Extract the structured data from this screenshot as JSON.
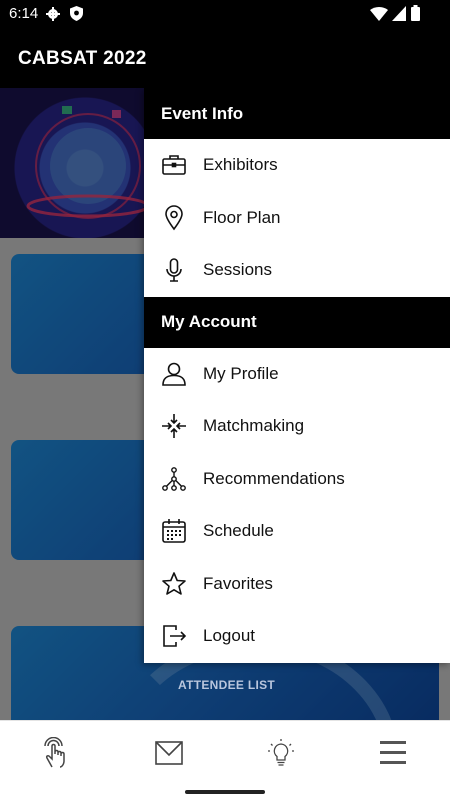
{
  "status_bar": {
    "time": "6:14",
    "icons": [
      "gear-icon",
      "shield-icon",
      "wifi-icon",
      "signal-icon",
      "battery-icon"
    ]
  },
  "app_bar": {
    "title": "CABSAT 2022"
  },
  "background": {
    "card_caption": "ATTENDEE LIST"
  },
  "drawer": {
    "sections": [
      {
        "title": "Event Info",
        "items": [
          {
            "label": "Exhibitors",
            "icon": "briefcase-icon"
          },
          {
            "label": "Floor Plan",
            "icon": "location-pin-icon"
          },
          {
            "label": "Sessions",
            "icon": "microphone-icon"
          }
        ]
      },
      {
        "title": "My Account",
        "items": [
          {
            "label": "My Profile",
            "icon": "user-icon"
          },
          {
            "label": "Matchmaking",
            "icon": "arrows-converge-icon"
          },
          {
            "label": "Recommendations",
            "icon": "network-icon"
          },
          {
            "label": "Schedule",
            "icon": "calendar-icon"
          },
          {
            "label": "Favorites",
            "icon": "star-icon"
          },
          {
            "label": "Logout",
            "icon": "logout-icon"
          }
        ]
      }
    ]
  },
  "bottom_nav": {
    "items": [
      "touch-icon",
      "mail-icon",
      "lightbulb-icon",
      "menu-icon"
    ]
  },
  "colors": {
    "header_bg": "#000000",
    "drawer_bg": "#ffffff",
    "card_blue": "#1a6cc9"
  }
}
